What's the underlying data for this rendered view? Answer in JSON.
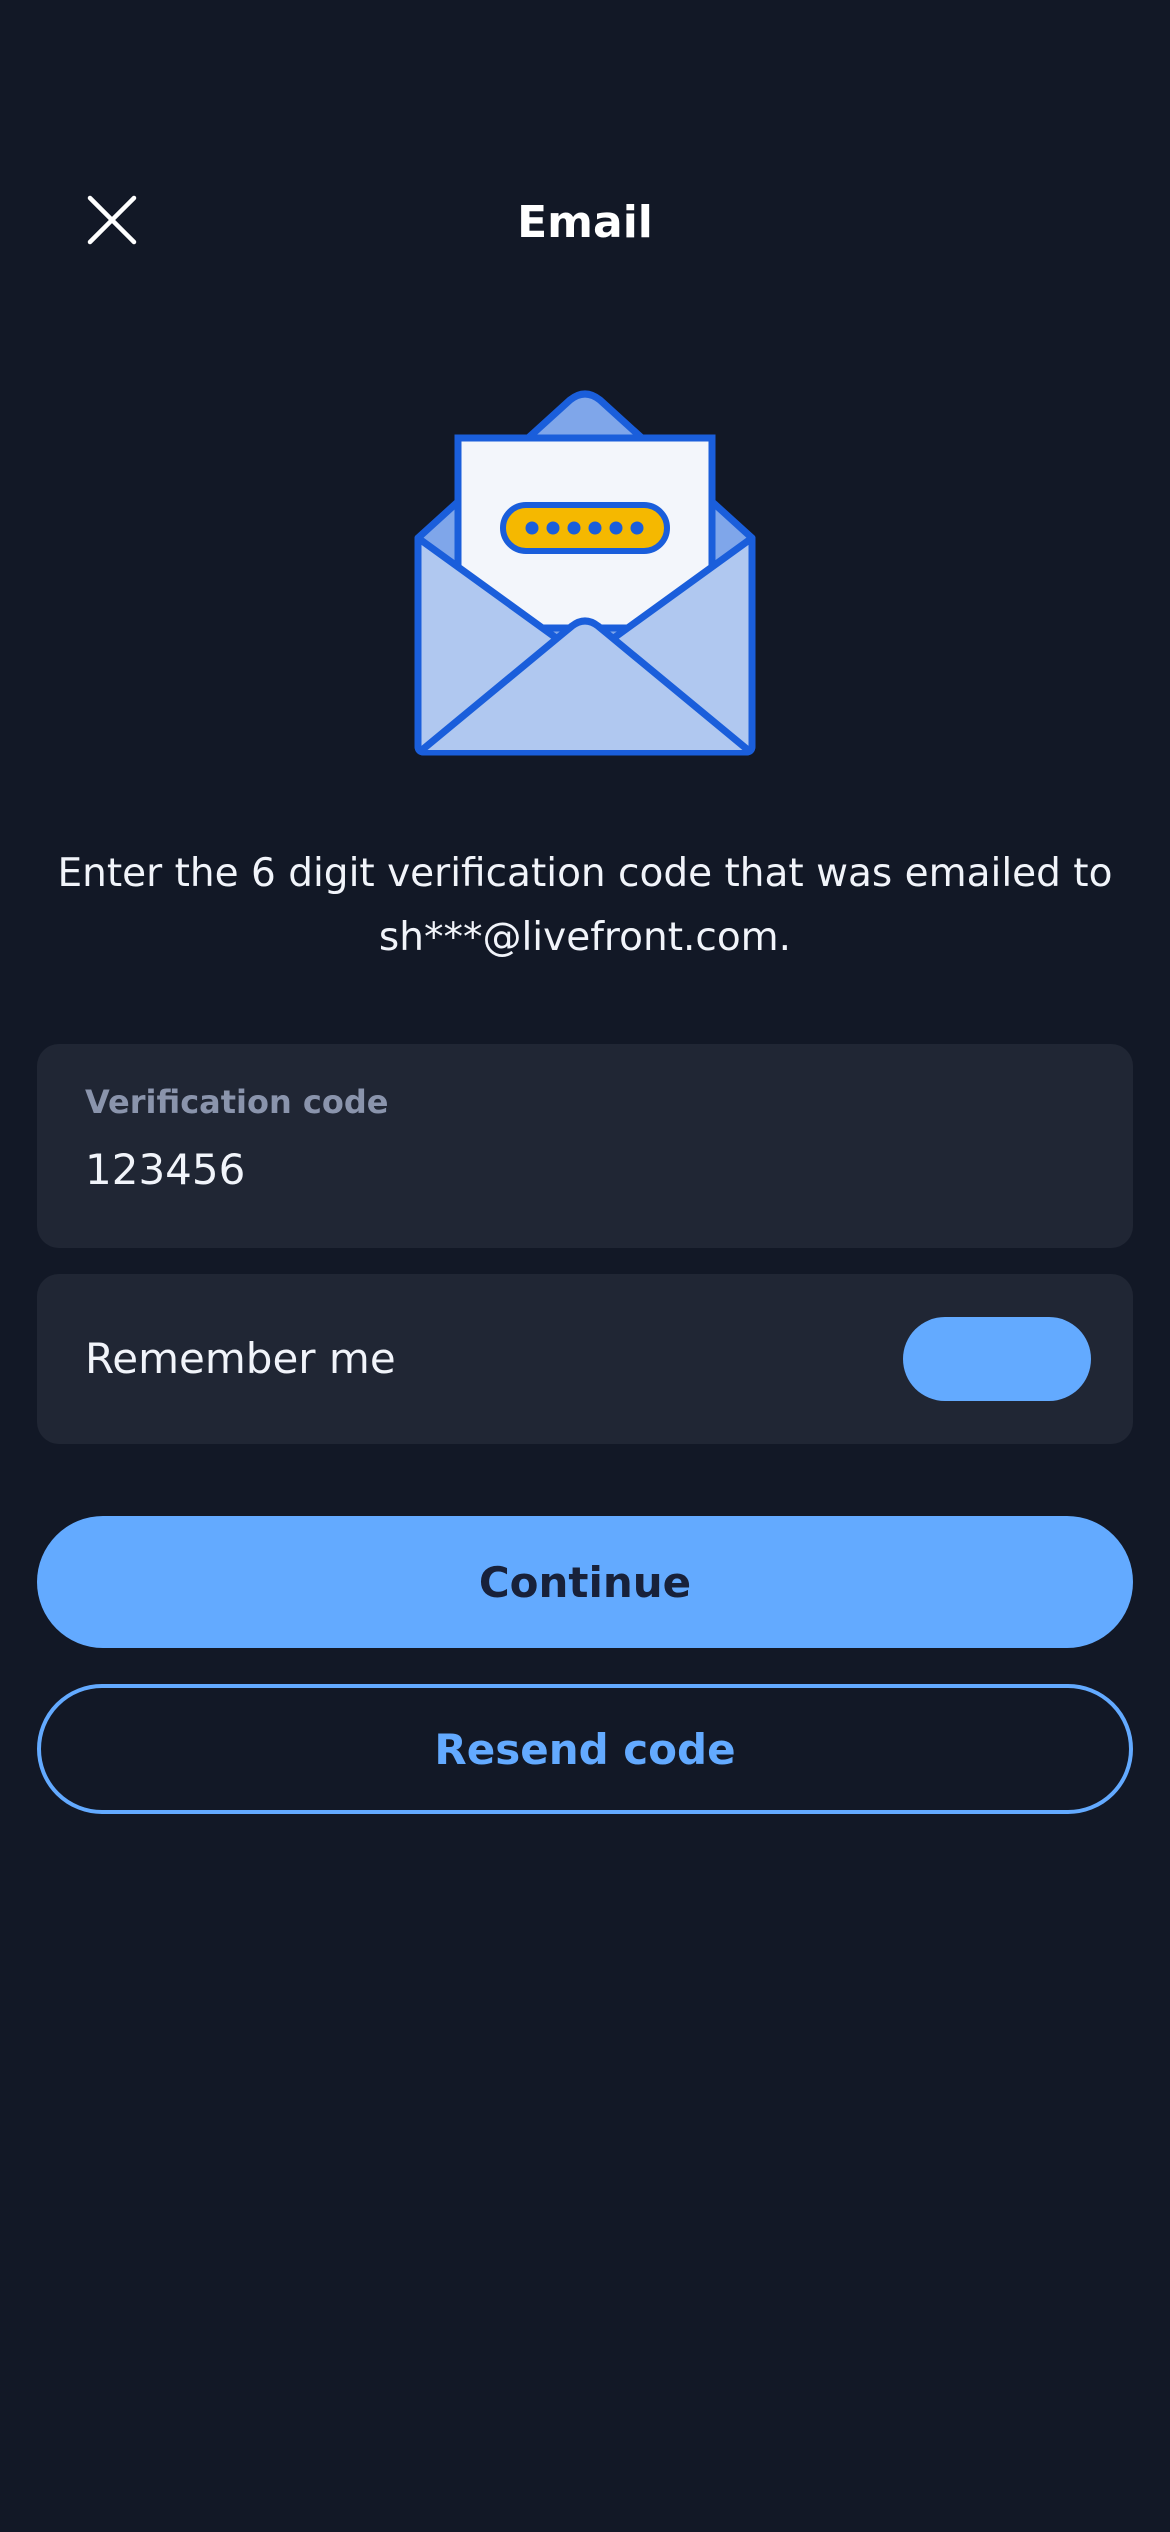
{
  "header": {
    "title": "Email",
    "close_icon": "close-icon"
  },
  "illustration": {
    "icon": "envelope-with-code-icon",
    "colors": {
      "stroke": "#1a5edb",
      "envelope_fill": "#b0c8f0",
      "flap_fill": "#7fa6ea",
      "paper_fill": "#f3f6fb",
      "code_pill": "#f5b800"
    }
  },
  "instruction": {
    "text": "Enter the 6 digit verification code that was emailed to sh***@livefront.com."
  },
  "verification": {
    "label": "Verification code",
    "value": "123456"
  },
  "remember_me": {
    "label": "Remember me",
    "enabled": true
  },
  "actions": {
    "continue_label": "Continue",
    "resend_label": "Resend code"
  },
  "colors": {
    "background": "#121826",
    "card": "#202634",
    "accent": "#63aaff"
  }
}
